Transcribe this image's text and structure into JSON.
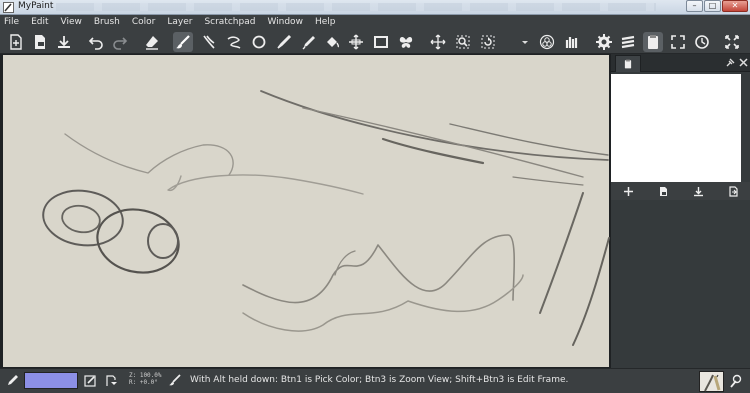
{
  "window": {
    "title": "MyPaint",
    "minimize": "–",
    "maximize": "□",
    "close": "✕"
  },
  "menubar": {
    "items": [
      "File",
      "Edit",
      "View",
      "Brush",
      "Color",
      "Layer",
      "Scratchpad",
      "Window",
      "Help"
    ]
  },
  "toolbar": {
    "tools": [
      "new-document-icon",
      "open-file-icon",
      "save-icon",
      "undo-icon",
      "redo-icon",
      "eraser-icon",
      "freehand-brush-icon",
      "brush-strokes-icon",
      "inking-icon",
      "ellipse-icon",
      "pen-nib-icon",
      "color-picker-icon",
      "fill-bucket-icon",
      "move-layer-icon",
      "frame-icon",
      "symmetry-butterfly-icon",
      "pan-view-icon",
      "zoom-view-icon",
      "rotate-view-icon",
      "dropdown-icon",
      "color-wheel-icon",
      "brush-palette-icon",
      "settings-gear-icon",
      "layers-icon",
      "scratchpad-icon",
      "fullscreen-icon",
      "clock-icon",
      "fit-view-icon"
    ],
    "active_tool": "freehand-brush-icon"
  },
  "side_panel": {
    "active_tab": "scratchpad-icon",
    "actions": [
      "add-icon",
      "load-icon",
      "save-scratch-icon",
      "export-icon"
    ]
  },
  "statusbar": {
    "current_color": "#8c8fe6",
    "zoom_line": "Z: 100.0%",
    "rotation_line": "R: +0.0°",
    "message": "With Alt held down:  Btn1 is Pick Color;  Btn3 is Zoom View;  Shift+Btn3 is Edit Frame."
  },
  "colors": {
    "canvas": "#d9d6cb",
    "chrome": "#3b3f41",
    "stroke": "#6e6c68"
  }
}
